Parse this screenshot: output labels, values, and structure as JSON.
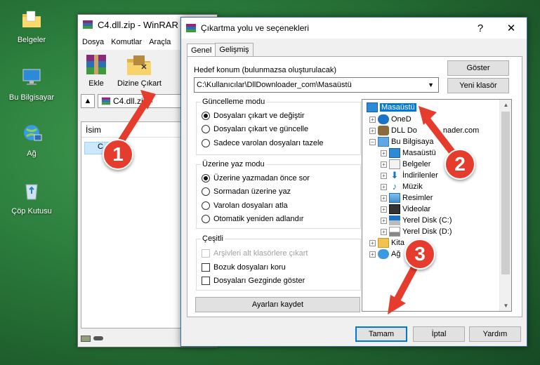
{
  "desktop": {
    "icons": [
      {
        "label": "Belgeler"
      },
      {
        "label": "Bu Bilgisayar"
      },
      {
        "label": "Ağ"
      },
      {
        "label": "Çöp Kutusu"
      }
    ]
  },
  "winrar": {
    "title": "C4.dll.zip - WinRAR",
    "menu": [
      "Dosya",
      "Komutlar",
      "Araçla"
    ],
    "toolbar": {
      "add_label": "Ekle",
      "extract_label": "Dizine Çıkart"
    },
    "path_value": "C4.dll.zip - ",
    "list_header": "İsim",
    "list_item": "C"
  },
  "dialog": {
    "title": "Çıkartma yolu ve seçenekleri",
    "help_button": "?",
    "close_button": "✕",
    "tabs": [
      {
        "label": "Genel"
      },
      {
        "label": "Gelişmiş"
      }
    ],
    "dest_label": "Hedef konum (bulunmazsa oluşturulacak)",
    "dest_value": "C:\\Kullanıcılar\\DllDownloader_com\\Masaüstü",
    "show_button": "Göster",
    "new_folder_button": "Yeni klasör",
    "update_group": {
      "title": "Güncelleme modu",
      "options": [
        "Dosyaları çıkart ve değiştir",
        "Dosyaları çıkart ve güncelle",
        "Sadece varolan dosyaları tazele"
      ]
    },
    "overwrite_group": {
      "title": "Üzerine yaz modu",
      "options": [
        "Üzerine yazmadan önce sor",
        "Sormadan üzerine yaz",
        "Varolan dosyaları atla",
        "Otomatik yeniden adlandır"
      ]
    },
    "misc_group": {
      "title": "Çeşitli",
      "options": [
        "Arşivleri alt klasörlere çıkart",
        "Bozuk dosyaları koru",
        "Dosyaları Gezginde göster"
      ]
    },
    "save_settings_button": "Ayarları kaydet",
    "tree": [
      {
        "label": "Masaüstü"
      },
      {
        "label": "OneD"
      },
      {
        "label": "DLL Do"
      },
      {
        "label": "Bu Bilgisaya"
      },
      {
        "label": "Masaüstü"
      },
      {
        "label": "Belgeler"
      },
      {
        "label": "İndirilenler"
      },
      {
        "label": "Müzik"
      },
      {
        "label": "Resimler"
      },
      {
        "label": "Videolar"
      },
      {
        "label": "Yerel Disk (C:)"
      },
      {
        "label": "Yerel Disk (D:)"
      },
      {
        "label": "Kita"
      },
      {
        "label": "Ağ"
      }
    ],
    "tree_tail": "nader.com",
    "ok_button": "Tamam",
    "cancel_button": "İptal",
    "help_bottom_button": "Yardım"
  },
  "callouts": [
    "1",
    "2",
    "3"
  ],
  "colors": {
    "selection": "#0078d7",
    "callout": "#e63c2d",
    "arrow": "#e63c2d"
  }
}
